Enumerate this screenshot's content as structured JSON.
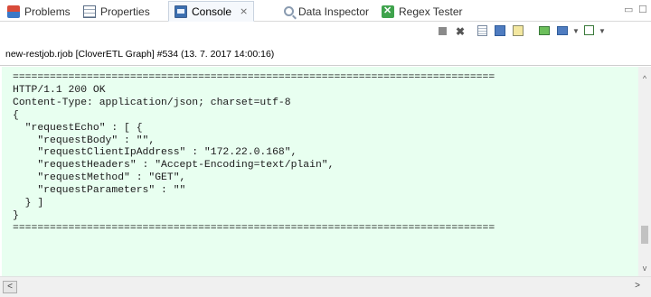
{
  "tabs": [
    {
      "label": "Problems",
      "icon": "problems-icon"
    },
    {
      "label": "Properties",
      "icon": "properties-icon"
    },
    {
      "label": "Console",
      "icon": "console-icon",
      "active": true,
      "close": "⨯"
    },
    {
      "label": "Data Inspector",
      "icon": "magnifier-icon"
    },
    {
      "label": "Regex Tester",
      "icon": "regex-icon"
    }
  ],
  "window_controls": {
    "minimize": "▭",
    "maximize": "☐"
  },
  "toolbar": {
    "icons": [
      "terminate-icon",
      "remove-launch-icon",
      "clear-console-icon",
      "scroll-lock-icon",
      "word-wrap-icon",
      "pin-console-icon",
      "display-selected-console-icon",
      "open-console-icon"
    ]
  },
  "status": {
    "text": "new-restjob.rjob [CloverETL Graph] #534 (13. 7. 2017 14:00:16)"
  },
  "console": {
    "lines": [
      "==============================================================================",
      "HTTP/1.1 200 OK",
      "Content-Type: application/json; charset=utf-8",
      "{",
      "  \"requestEcho\" : [ {",
      "    \"requestBody\" : \"\",",
      "    \"requestClientIpAddress\" : \"172.22.0.168\",",
      "    \"requestHeaders\" : \"Accept-Encoding=text/plain\",",
      "    \"requestMethod\" : \"GET\",",
      "    \"requestParameters\" : \"\"",
      "  } ]",
      "}",
      "=============================================================================="
    ]
  },
  "colors": {
    "console_background": "#e8fff0",
    "active_tab_background": "#f5f8fc"
  }
}
